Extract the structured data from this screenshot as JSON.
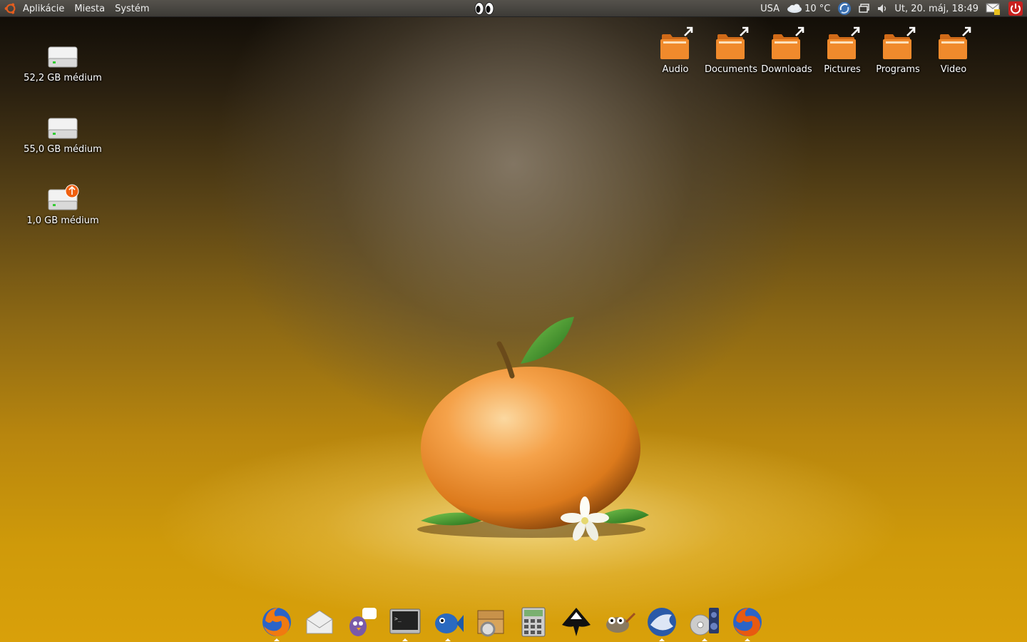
{
  "panel": {
    "menus": [
      "Aplikácie",
      "Miesta",
      "Systém"
    ],
    "keyboard_layout": "USA",
    "weather": "10 °C",
    "clock": "Ut, 20. máj, 18:49"
  },
  "drives": [
    {
      "label": "52,2 GB médium"
    },
    {
      "label": "55,0 GB médium"
    },
    {
      "label": "1,0 GB médium"
    }
  ],
  "folders": [
    {
      "label": "Audio"
    },
    {
      "label": "Documents"
    },
    {
      "label": "Downloads"
    },
    {
      "label": "Pictures"
    },
    {
      "label": "Programs"
    },
    {
      "label": "Video"
    }
  ],
  "dock": [
    {
      "icon": "firefox-icon",
      "running": true
    },
    {
      "icon": "mail-icon",
      "running": false
    },
    {
      "icon": "pidgin-icon",
      "running": false
    },
    {
      "icon": "terminal-icon",
      "running": true
    },
    {
      "icon": "fish-icon",
      "running": true
    },
    {
      "icon": "package-manager-icon",
      "running": false
    },
    {
      "icon": "calculator-icon",
      "running": false
    },
    {
      "icon": "inkscape-icon",
      "running": false
    },
    {
      "icon": "gimp-icon",
      "running": false
    },
    {
      "icon": "thunderbird-icon",
      "running": true
    },
    {
      "icon": "media-player-icon",
      "running": true
    },
    {
      "icon": "firefox-alt-icon",
      "running": true
    }
  ],
  "colors": {
    "folder": "#f08a2c",
    "panel": "#3c3a36",
    "accent": "#e35d1f"
  }
}
